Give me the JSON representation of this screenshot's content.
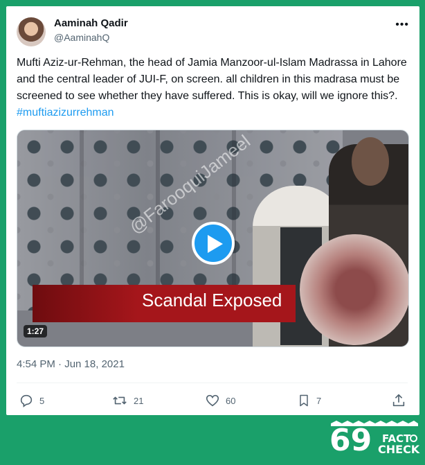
{
  "tweet": {
    "display_name": "Aaminah Qadir",
    "handle": "@AaminahQ",
    "more_label": "•••",
    "text": "Mufti Aziz-ur-Rehman, the head of Jamia Manzoor-ul-Islam Madrassa in Lahore and the central leader of JUI-F, on screen. all children in this madrasa must be screened to see whether they have suffered. This is okay, will we ignore this?. ",
    "hashtag": "#muftiazizurrehman",
    "timestamp": "4:54 PM · Jun 18, 2021"
  },
  "media": {
    "banner_text": "Scandal Exposed",
    "watermark": "@FarooquiJameel",
    "duration": "1:27",
    "play_icon": "play-icon"
  },
  "actions": {
    "replies": "5",
    "retweets": "21",
    "likes": "60",
    "bookmarks": "7",
    "icons": [
      "reply-icon",
      "retweet-icon",
      "like-icon",
      "bookmark-icon",
      "share-icon"
    ]
  },
  "logo": {
    "number": "69",
    "text_line1": "FACT",
    "text_line2": "CHECK"
  },
  "colors": {
    "background": "#1aa06a",
    "accent": "#1d9bf0",
    "banner": "#a5161b"
  }
}
